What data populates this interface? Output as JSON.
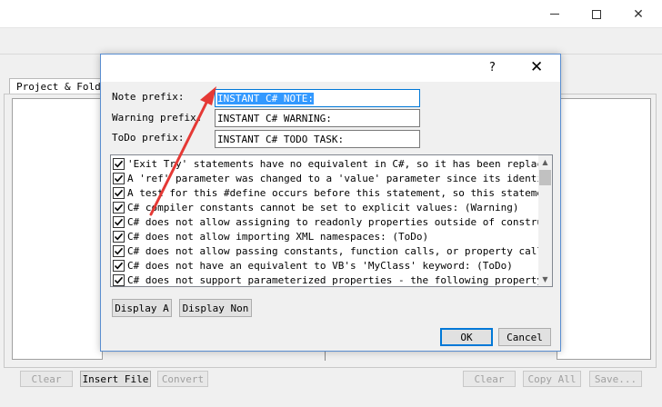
{
  "main": {
    "tab_label": "Project & Folder",
    "bottom_buttons": {
      "clear_left": "Clear",
      "insert_file": "Insert File",
      "convert": "Convert",
      "clear_right": "Clear",
      "copy_all": "Copy All",
      "save": "Save..."
    }
  },
  "dialog": {
    "help_label": "?",
    "close_label": "✕",
    "fields": {
      "note_label": "Note prefix:",
      "note_value": "INSTANT C# NOTE:",
      "warning_label": "Warning prefix:",
      "warning_value": "INSTANT C# WARNING:",
      "todo_label": "ToDo prefix:",
      "todo_value": "INSTANT C# TODO TASK:"
    },
    "list_items": [
      "'Exit Try' statements have no equivalent in C#, so it has been replaced with",
      "A 'ref' parameter was changed to a 'value' parameter since its identity doesn't",
      "A test for this #define occurs before this statement, so this statement can",
      "C# compiler constants cannot be set to explicit values: (Warning)",
      "C# does not allow assigning to readonly properties outside of constructors",
      "C# does not allow importing XML namespaces: (ToDo)",
      "C# does not allow passing constants, function calls, or property calls as",
      "C# does not have an equivalent to VB's 'MyClass' keyword: (ToDo)",
      "C# does not support parameterized properties - the following property has"
    ],
    "display_all": "Display A",
    "display_none": "Display Non",
    "ok": "OK",
    "cancel": "Cancel"
  },
  "colors": {
    "selection": "#3399ff",
    "dialog_border": "#5a8ed0",
    "annotation_arrow": "#e53935"
  }
}
